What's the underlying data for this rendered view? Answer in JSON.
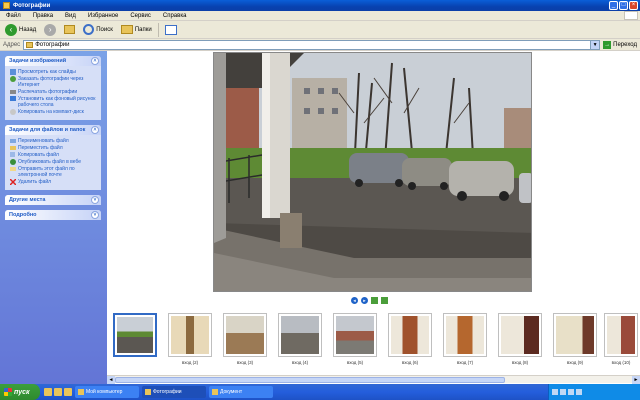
{
  "window": {
    "title": "Фотографии",
    "controls": {
      "minimize": "_",
      "maximize": "□",
      "close": "×"
    }
  },
  "menu": [
    "Файл",
    "Правка",
    "Вид",
    "Избранное",
    "Сервис",
    "Справка"
  ],
  "toolbar": {
    "back": "Назад",
    "search": "Поиск",
    "folders": "Папки"
  },
  "address": {
    "label": "Адрес",
    "value": "Фотографии",
    "go": "Переход"
  },
  "left_pane": {
    "image_tasks": {
      "title": "Задачи изображений",
      "items": [
        "Просмотреть как слайды",
        "Заказать фотографии через Интернет",
        "Распечатать фотографии",
        "Установить как фоновый рисунок рабочего стола",
        "Копировать на компакт-диск"
      ]
    },
    "file_tasks": {
      "title": "Задачи для файлов и папок",
      "items": [
        "Переименовать файл",
        "Переместить файл",
        "Копировать файл",
        "Опубликовать файл в вебе",
        "Отправить этот файл по электронной почте",
        "Удалить файл"
      ]
    },
    "other_places": {
      "title": "Другие места"
    },
    "details": {
      "title": "Подробно"
    }
  },
  "viewer": {
    "controls": {
      "prev": "◄",
      "next": "►"
    }
  },
  "thumbnails": [
    {
      "label": "",
      "selected": true
    },
    {
      "label": "вход (2)",
      "selected": false
    },
    {
      "label": "вход (3)",
      "selected": false
    },
    {
      "label": "вход (4)",
      "selected": false
    },
    {
      "label": "вход (5)",
      "selected": false
    },
    {
      "label": "вход (6)",
      "selected": false
    },
    {
      "label": "вход (7)",
      "selected": false
    },
    {
      "label": "вход (8)",
      "selected": false
    },
    {
      "label": "вход (9)",
      "selected": false
    },
    {
      "label": "вход (10)",
      "selected": false
    }
  ],
  "taskbar": {
    "start": "пуск",
    "tasks": [
      {
        "label": "Мой компьютер",
        "active": false
      },
      {
        "label": "Фотографии",
        "active": true
      },
      {
        "label": "Документ",
        "active": false
      }
    ],
    "clock": ""
  },
  "colors": {
    "xp_blue": "#245EDC",
    "task_link": "#215DC6",
    "selection": "#316AC5",
    "start_green": "#2E8A2E"
  }
}
